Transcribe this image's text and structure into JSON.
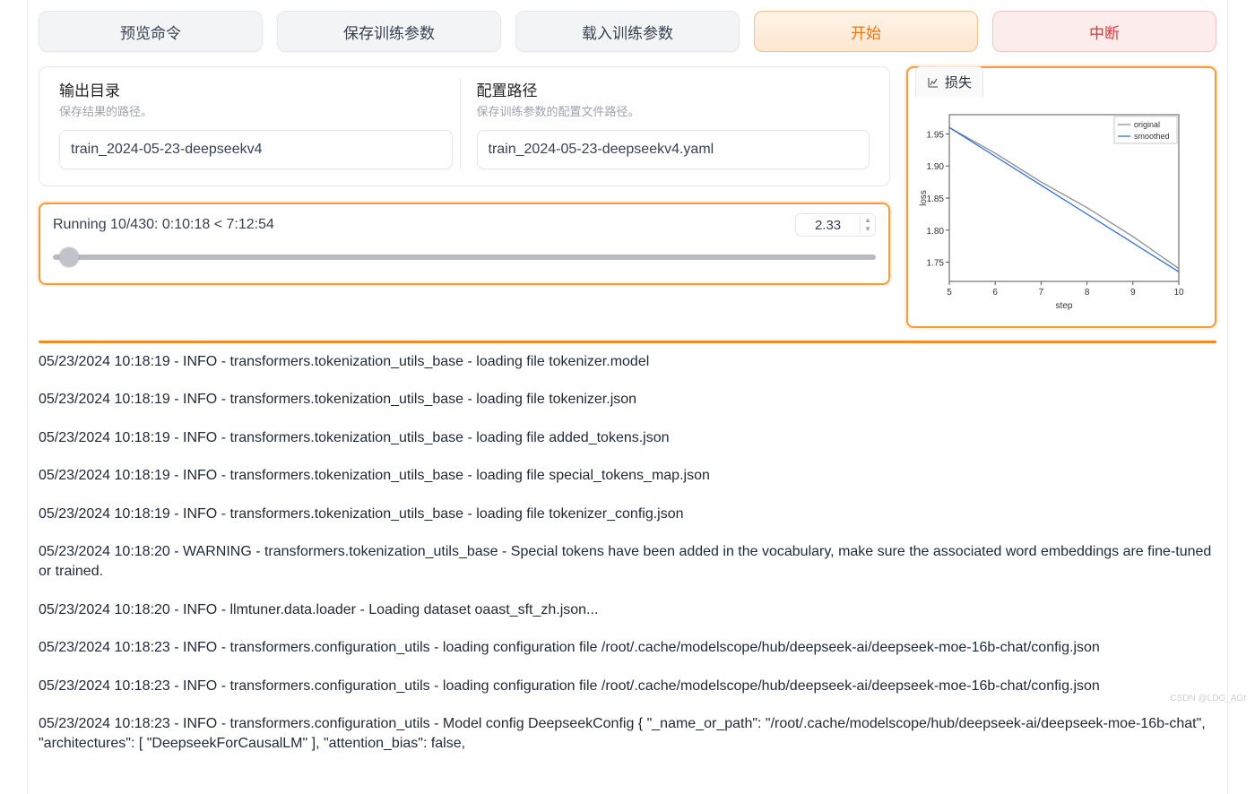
{
  "buttons": {
    "preview": "预览命令",
    "save_params": "保存训练参数",
    "load_params": "载入训练参数",
    "start": "开始",
    "abort": "中断"
  },
  "output_dir": {
    "label": "输出目录",
    "sub": "保存结果的路径。",
    "value": "train_2024-05-23-deepseekv4"
  },
  "config_path": {
    "label": "配置路径",
    "sub": "保存训练参数的配置文件路径。",
    "value": "train_2024-05-23-deepseekv4.yaml"
  },
  "status": {
    "text": "Running 10/430: 0:10:18 < 7:12:54",
    "spinner": "2.33",
    "slider_percent": 2.33
  },
  "chart_tab": "损失",
  "chart_data": {
    "type": "line",
    "title": "",
    "xlabel": "step",
    "ylabel": "loss",
    "x": [
      5,
      6,
      7,
      8,
      9,
      10
    ],
    "yticks": [
      1.75,
      1.8,
      1.85,
      1.9,
      1.95
    ],
    "ylim": [
      1.72,
      1.98
    ],
    "series": [
      {
        "name": "original",
        "color": "#8a8f98",
        "values": [
          1.96,
          1.92,
          1.875,
          1.835,
          1.79,
          1.74
        ]
      },
      {
        "name": "smoothed",
        "color": "#2f6fd1",
        "values": [
          1.96,
          1.915,
          1.87,
          1.825,
          1.78,
          1.735
        ]
      }
    ]
  },
  "logs": [
    "05/23/2024 10:18:19 - INFO - transformers.tokenization_utils_base - loading file tokenizer.model",
    "05/23/2024 10:18:19 - INFO - transformers.tokenization_utils_base - loading file tokenizer.json",
    "05/23/2024 10:18:19 - INFO - transformers.tokenization_utils_base - loading file added_tokens.json",
    "05/23/2024 10:18:19 - INFO - transformers.tokenization_utils_base - loading file special_tokens_map.json",
    "05/23/2024 10:18:19 - INFO - transformers.tokenization_utils_base - loading file tokenizer_config.json",
    "05/23/2024 10:18:20 - WARNING - transformers.tokenization_utils_base - Special tokens have been added in the vocabulary, make sure the associated word embeddings are fine-tuned or trained.",
    "05/23/2024 10:18:20 - INFO - llmtuner.data.loader - Loading dataset oaast_sft_zh.json...",
    "05/23/2024 10:18:23 - INFO - transformers.configuration_utils - loading configuration file /root/.cache/modelscope/hub/deepseek-ai/deepseek-moe-16b-chat/config.json",
    "05/23/2024 10:18:23 - INFO - transformers.configuration_utils - loading configuration file /root/.cache/modelscope/hub/deepseek-ai/deepseek-moe-16b-chat/config.json",
    "05/23/2024 10:18:23 - INFO - transformers.configuration_utils - Model config DeepseekConfig { \"_name_or_path\": \"/root/.cache/modelscope/hub/deepseek-ai/deepseek-moe-16b-chat\", \"architectures\": [ \"DeepseekForCausalLM\" ], \"attention_bias\": false,"
  ],
  "watermark": "CSDN @LDG_AGI"
}
